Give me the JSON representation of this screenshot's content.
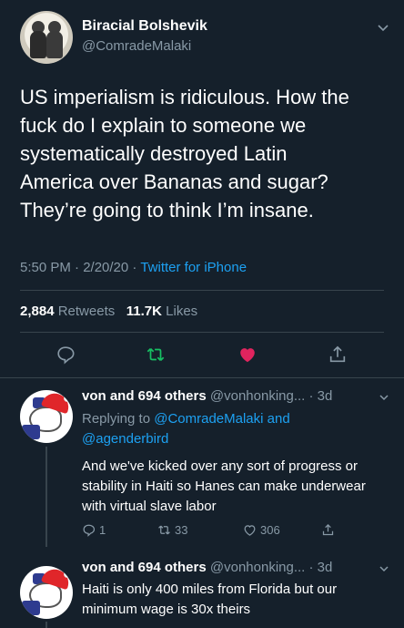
{
  "main": {
    "display_name": "Biracial Bolshevik",
    "handle": "@ComradeMalaki",
    "text": "US imperialism is ridiculous. How the\nfuck do I explain to someone we\nsystematically destroyed Latin\nAmerica over Bananas and sugar?\nThey’re going to think I’m insane.",
    "time": "5:50 PM · 2/20/20 · ",
    "source": "Twitter for iPhone",
    "retweets_count": "2,884",
    "retweets_label": "Retweets",
    "likes_count": "11.7K",
    "likes_label": "Likes",
    "icons": [
      "reply-icon",
      "retweet-icon",
      "heart-icon",
      "share-icon"
    ],
    "colors": {
      "retweet": "#17bf63",
      "like": "#e0245e",
      "link": "#1da1f2"
    }
  },
  "replies": [
    {
      "name": "von and 694 others",
      "handle_time": "@vonhonking... · 3d",
      "replying_prefix": "Replying to ",
      "replying_user1": "@ComradeMalaki",
      "replying_and": " and",
      "replying_user2": "@agenderbird",
      "text": "And we've kicked over any sort of progress or stability in Haiti so Hanes can make underwear with virtual slave labor",
      "reply_count": "1",
      "retweet_count": "33",
      "like_count": "306"
    },
    {
      "name": "von and 694 others",
      "handle_time": "@vonhonking... · 3d",
      "text": "Haiti is only 400 miles from Florida but our minimum wage is 30x theirs"
    }
  ]
}
